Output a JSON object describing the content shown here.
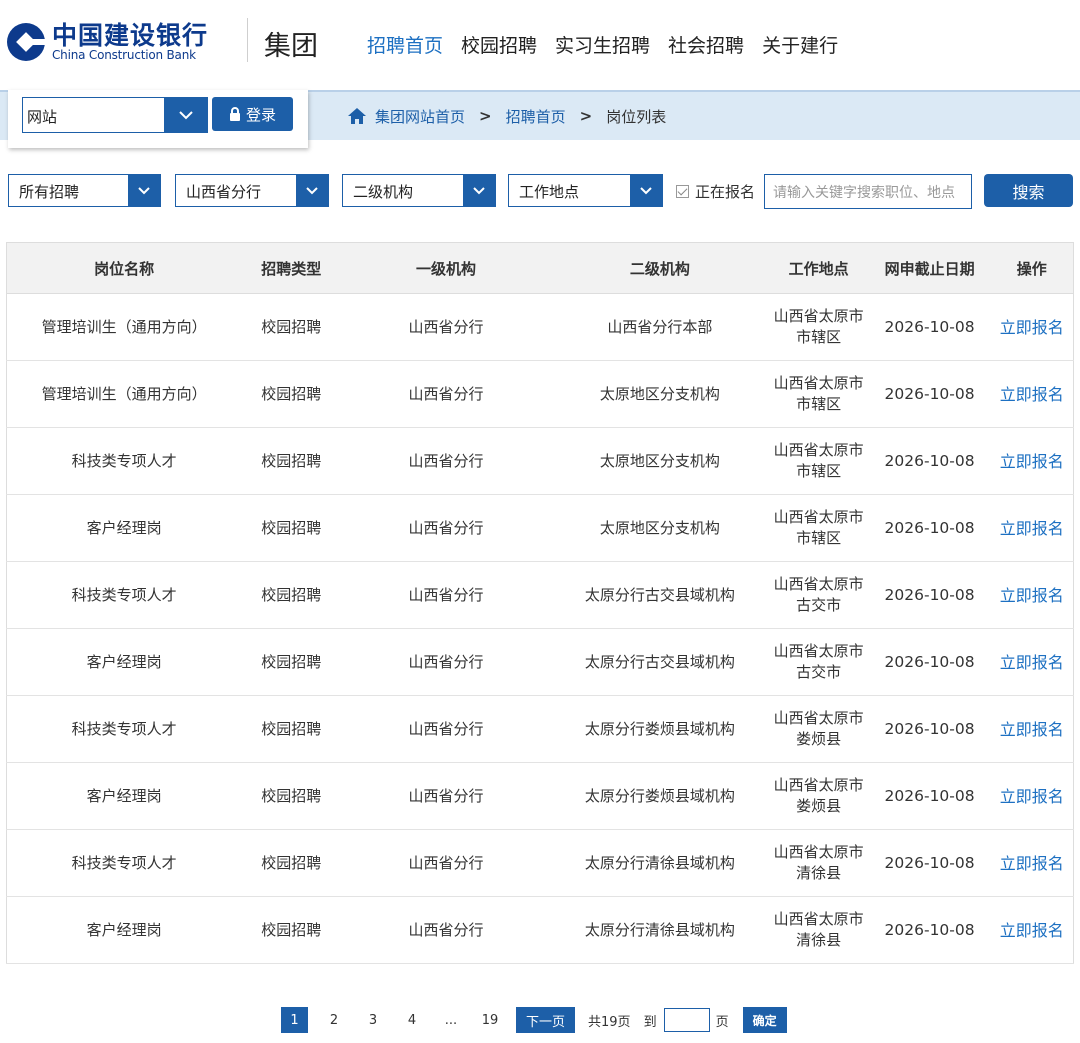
{
  "brand": {
    "name_cn": "中国建设银行",
    "name_en": "China Construction Bank",
    "group_label": "集团",
    "color": "#1d5fa8"
  },
  "nav": {
    "items": [
      {
        "label": "招聘首页",
        "active": true
      },
      {
        "label": "校园招聘",
        "active": false
      },
      {
        "label": "实习生招聘",
        "active": false
      },
      {
        "label": "社会招聘",
        "active": false
      },
      {
        "label": "关于建行",
        "active": false
      }
    ]
  },
  "login_box": {
    "site_select_value": "网站",
    "login_label": "登录"
  },
  "breadcrumb": {
    "home_label": "集团网站首页",
    "separator": ">",
    "recruit_label": "招聘首页",
    "current_label": "岗位列表"
  },
  "filters": {
    "recruit_type": "所有招聘",
    "level1_org": "山西省分行",
    "level2_org": "二级机构",
    "location": "工作地点",
    "open_only_label": "正在报名",
    "search_placeholder": "请输入关键字搜索职位、地点",
    "search_button": "搜索"
  },
  "table": {
    "headers": [
      "岗位名称",
      "招聘类型",
      "一级机构",
      "二级机构",
      "工作地点",
      "网申截止日期",
      "操作"
    ],
    "rows": [
      {
        "title": "管理培训生（通用方向）",
        "type": "校园招聘",
        "org1": "山西省分行",
        "org2": "山西省分行本部",
        "loc1": "山西省太原市",
        "loc2": "市辖区",
        "deadline": "2026-10-08",
        "action": "立即报名"
      },
      {
        "title": "管理培训生（通用方向）",
        "type": "校园招聘",
        "org1": "山西省分行",
        "org2": "太原地区分支机构",
        "loc1": "山西省太原市",
        "loc2": "市辖区",
        "deadline": "2026-10-08",
        "action": "立即报名"
      },
      {
        "title": "科技类专项人才",
        "type": "校园招聘",
        "org1": "山西省分行",
        "org2": "太原地区分支机构",
        "loc1": "山西省太原市",
        "loc2": "市辖区",
        "deadline": "2026-10-08",
        "action": "立即报名"
      },
      {
        "title": "客户经理岗",
        "type": "校园招聘",
        "org1": "山西省分行",
        "org2": "太原地区分支机构",
        "loc1": "山西省太原市",
        "loc2": "市辖区",
        "deadline": "2026-10-08",
        "action": "立即报名"
      },
      {
        "title": "科技类专项人才",
        "type": "校园招聘",
        "org1": "山西省分行",
        "org2": "太原分行古交县域机构",
        "loc1": "山西省太原市",
        "loc2": "古交市",
        "deadline": "2026-10-08",
        "action": "立即报名"
      },
      {
        "title": "客户经理岗",
        "type": "校园招聘",
        "org1": "山西省分行",
        "org2": "太原分行古交县域机构",
        "loc1": "山西省太原市",
        "loc2": "古交市",
        "deadline": "2026-10-08",
        "action": "立即报名"
      },
      {
        "title": "科技类专项人才",
        "type": "校园招聘",
        "org1": "山西省分行",
        "org2": "太原分行娄烦县域机构",
        "loc1": "山西省太原市",
        "loc2": "娄烦县",
        "deadline": "2026-10-08",
        "action": "立即报名"
      },
      {
        "title": "客户经理岗",
        "type": "校园招聘",
        "org1": "山西省分行",
        "org2": "太原分行娄烦县域机构",
        "loc1": "山西省太原市",
        "loc2": "娄烦县",
        "deadline": "2026-10-08",
        "action": "立即报名"
      },
      {
        "title": "科技类专项人才",
        "type": "校园招聘",
        "org1": "山西省分行",
        "org2": "太原分行清徐县域机构",
        "loc1": "山西省太原市",
        "loc2": "清徐县",
        "deadline": "2026-10-08",
        "action": "立即报名"
      },
      {
        "title": "客户经理岗",
        "type": "校园招聘",
        "org1": "山西省分行",
        "org2": "太原分行清徐县域机构",
        "loc1": "山西省太原市",
        "loc2": "清徐县",
        "deadline": "2026-10-08",
        "action": "立即报名"
      }
    ]
  },
  "pagination": {
    "pages": [
      "1",
      "2",
      "3",
      "4"
    ],
    "current": "1",
    "ellipsis": "...",
    "last": "19",
    "next_label": "下一页",
    "total_label": "共19页",
    "goto_prefix": "到",
    "goto_suffix": "页",
    "confirm_label": "确定"
  }
}
